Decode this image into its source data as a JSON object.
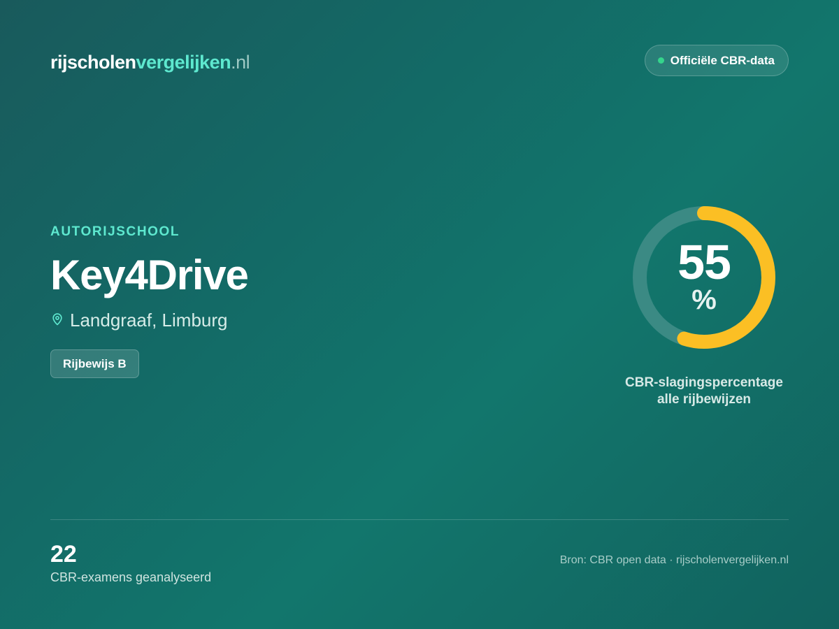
{
  "logo": {
    "part1": "rijscholen",
    "part2": "vergelijken",
    "part3": ".nl"
  },
  "badge": {
    "label": "Officiële CBR-data",
    "dot_color": "#35d58c"
  },
  "school": {
    "category": "AUTORIJSCHOOL",
    "name": "Key4Drive",
    "location_icon": "map-pin-icon",
    "location": "Landgraaf, Limburg",
    "license_tag": "Rijbewijs B"
  },
  "pass_rate": {
    "value": "55",
    "unit": "%",
    "fraction": 0.55,
    "caption_line1": "CBR-slagingspercentage",
    "caption_line2": "alle rijbewijzen",
    "ring_color": "#fbbf24",
    "track_color": "#3b8a84"
  },
  "exams": {
    "count": "22",
    "label": "CBR-examens geanalyseerd"
  },
  "source": {
    "text": "Bron: CBR open data · rijscholenvergelijken.nl"
  },
  "colors": {
    "accent": "#5ee8cf",
    "background_start": "#195a5c",
    "background_end": "#11625e"
  }
}
